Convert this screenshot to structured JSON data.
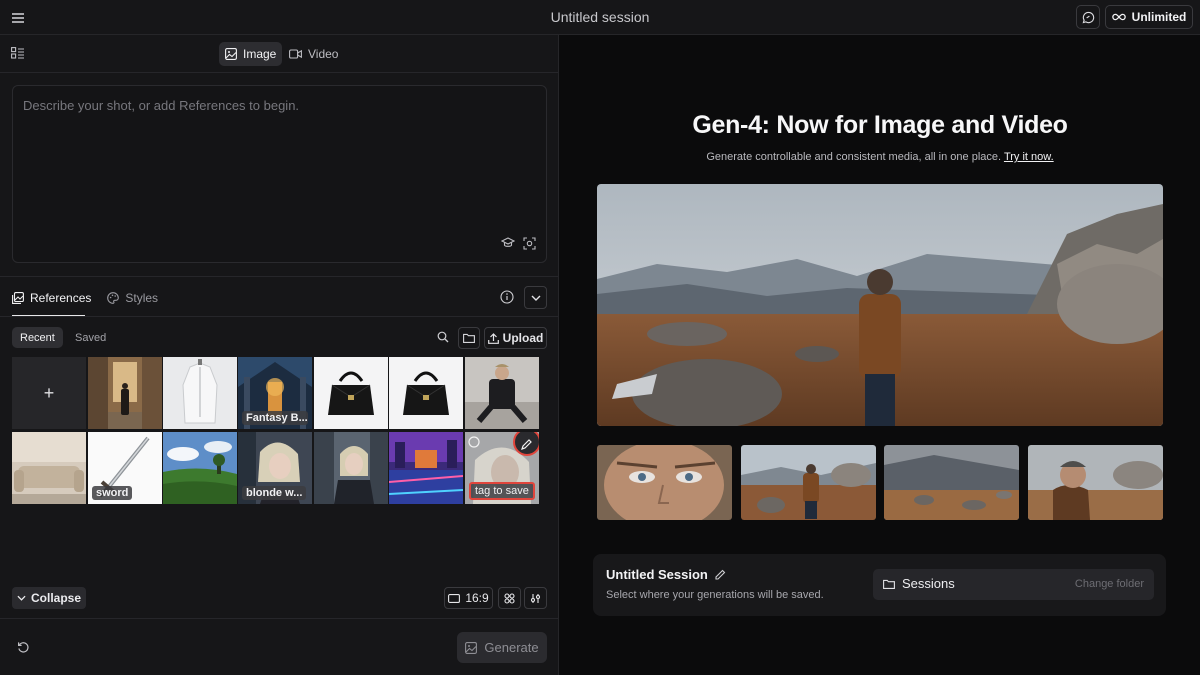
{
  "topbar": {
    "title": "Untitled session",
    "unlimited_label": "Unlimited",
    "icons": [
      "hamburger-menu-icon",
      "chat-icon",
      "infinity-icon"
    ]
  },
  "mode_tabs": [
    {
      "label": "Image",
      "active": true,
      "icon": "image-icon"
    },
    {
      "label": "Video",
      "active": false,
      "icon": "video-camera-icon"
    }
  ],
  "prompt": {
    "placeholder": "Describe your shot, or add References to begin."
  },
  "references": {
    "tabs": [
      {
        "label": "References",
        "active": true
      },
      {
        "label": "Styles",
        "active": false
      }
    ],
    "filters": [
      {
        "label": "Recent",
        "active": true
      },
      {
        "label": "Saved",
        "active": false
      }
    ],
    "upload_label": "Upload",
    "add_symbol": "+",
    "tiles": [
      {
        "label": "",
        "scene": "add"
      },
      {
        "label": "",
        "scene": "alley"
      },
      {
        "label": "",
        "scene": "coat"
      },
      {
        "label": "Fantasy B...",
        "scene": "fantasy"
      },
      {
        "label": "",
        "scene": "bag"
      },
      {
        "label": "",
        "scene": "bag"
      },
      {
        "label": "",
        "scene": "man-chair"
      },
      {
        "label": "",
        "scene": "sofa"
      },
      {
        "label": "sword",
        "scene": "sword"
      },
      {
        "label": "",
        "scene": "field"
      },
      {
        "label": "blonde w...",
        "scene": "blonde"
      },
      {
        "label": "",
        "scene": "blonde-alley"
      },
      {
        "label": "",
        "scene": "neon-city"
      },
      {
        "label": "tag to save",
        "scene": "portrait-edit"
      }
    ]
  },
  "footer": {
    "collapse_label": "Collapse",
    "ratio_label": "16:9",
    "generate_label": "Generate"
  },
  "hero": {
    "title": "Gen-4: Now for Image and Video",
    "subtitle": "Generate controllable and consistent media, all in one place.",
    "link": "Try it now."
  },
  "session": {
    "name": "Untitled Session",
    "hint": "Select where your generations will be saved.",
    "folder_label": "Sessions",
    "change_folder_label": "Change folder"
  },
  "colors": {
    "background": "#0b0b0c",
    "panel": "#161618",
    "highlight_red": "#e0453c"
  }
}
